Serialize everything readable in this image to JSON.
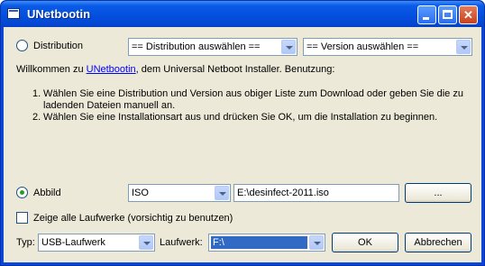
{
  "window": {
    "title": "UNetbootin"
  },
  "distribution": {
    "radio_label": "Distribution",
    "selected": false,
    "distro_select": "== Distribution auswählen ==",
    "version_select": "== Version auswählen =="
  },
  "welcome": {
    "prefix": "Willkommen zu ",
    "link": "UNetbootin",
    "suffix": ", dem Universal Netboot Installer. Benutzung:",
    "steps": [
      {
        "num": "1.",
        "text": "Wählen Sie eine Distribution und Version aus obiger Liste zum Download oder geben Sie die zu ladenden Dateien manuell an."
      },
      {
        "num": "2.",
        "text": "Wählen Sie eine Installationsart aus und drücken Sie OK, um die Installation zu beginnen."
      }
    ]
  },
  "diskimage": {
    "radio_label": "Abbild",
    "selected": true,
    "type_select": "ISO",
    "path": "E:\\desinfect-2011.iso",
    "browse_label": "..."
  },
  "show_all_drives": {
    "label": "Zeige alle Laufwerke (vorsichtig zu benutzen)",
    "checked": false
  },
  "bottom": {
    "type_label": "Typ:",
    "type_select": "USB-Laufwerk",
    "drive_label": "Laufwerk:",
    "drive_select": "F:\\",
    "ok_label": "OK",
    "cancel_label": "Abbrechen"
  }
}
